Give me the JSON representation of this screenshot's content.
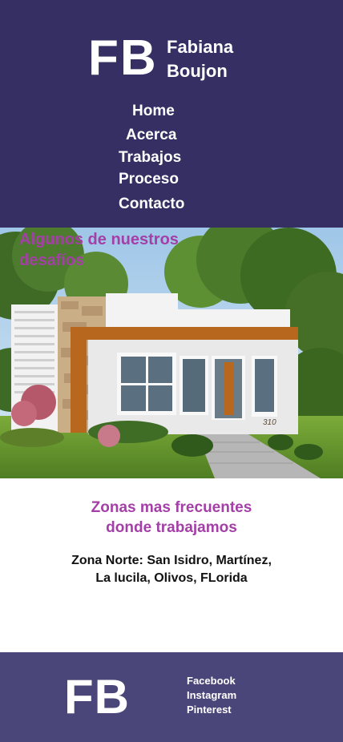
{
  "header": {
    "logo": "FB",
    "brand_line1": "Fabiana",
    "brand_line2": "Boujon",
    "nav": [
      "Home",
      "Acerca",
      "Trabajos",
      "Proceso",
      "Contacto"
    ]
  },
  "hero": {
    "title": "Algunos de nuestros desafíos",
    "house_number": "310"
  },
  "zones": {
    "title_line1": "Zonas mas frecuentes",
    "title_line2": "donde trabajamos",
    "text_line1": "Zona Norte: San Isidro, Martínez,",
    "text_line2": "La lucila, Olivos, FLorida"
  },
  "footer": {
    "logo": "FB",
    "social": [
      "Facebook",
      "Instagram",
      "Pinterest"
    ]
  },
  "colors": {
    "header_bg": "#362F63",
    "footer_bg": "#4B4679",
    "accent": "#A33FA6"
  }
}
